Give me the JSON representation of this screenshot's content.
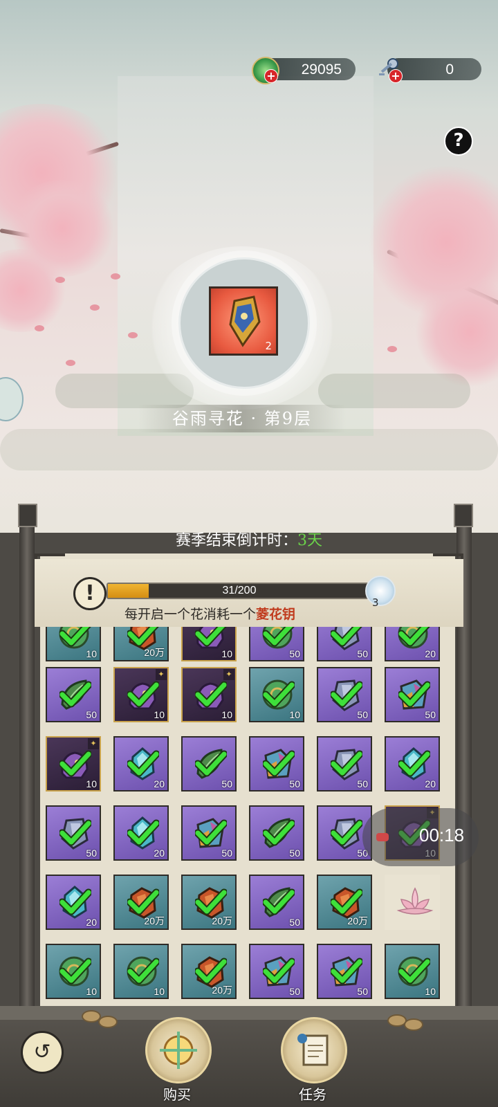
{
  "currency": {
    "jade": {
      "value": "29095",
      "icon": "jade-coin-icon"
    },
    "key": {
      "value": "0",
      "icon": "key-icon"
    }
  },
  "help": {
    "label": "?"
  },
  "reward": {
    "count": "2",
    "icon": "shield-charm-icon"
  },
  "stage_title": "谷雨寻花 · 第9层",
  "season": {
    "prefix": "赛季结束倒计时：",
    "days": "3天"
  },
  "progress": {
    "text": "31/200",
    "fraction": 0.155,
    "orb_count": "3"
  },
  "tip": {
    "prefix": "每开启一个花消耗一个",
    "key": "菱花钥"
  },
  "grid_rows": [
    [
      {
        "c": "blue",
        "g": "jade",
        "q": "10"
      },
      {
        "c": "blue",
        "g": "amber",
        "q": "20万"
      },
      {
        "c": "dark",
        "g": "beast",
        "q": "10"
      },
      {
        "c": "purple",
        "g": "jade",
        "q": "50"
      },
      {
        "c": "purple",
        "g": "crystal",
        "q": "50"
      },
      {
        "c": "purple",
        "g": "jade",
        "q": "20"
      }
    ],
    [
      {
        "c": "purple",
        "g": "leaf",
        "q": "50"
      },
      {
        "c": "dark",
        "g": "beast",
        "q": "10"
      },
      {
        "c": "dark",
        "g": "beast",
        "q": "10"
      },
      {
        "c": "blue",
        "g": "jade",
        "q": "10"
      },
      {
        "c": "purple",
        "g": "crystal",
        "q": "50"
      },
      {
        "c": "purple",
        "g": "rainbow",
        "q": "50"
      }
    ],
    [
      {
        "c": "dark",
        "g": "beast",
        "q": "10"
      },
      {
        "c": "purple",
        "g": "cyan",
        "q": "20"
      },
      {
        "c": "purple",
        "g": "leaf",
        "q": "50"
      },
      {
        "c": "purple",
        "g": "rainbow",
        "q": "50"
      },
      {
        "c": "purple",
        "g": "crystal",
        "q": "50"
      },
      {
        "c": "purple",
        "g": "cyan",
        "q": "20"
      }
    ],
    [
      {
        "c": "purple",
        "g": "crystal",
        "q": "50"
      },
      {
        "c": "purple",
        "g": "cyan",
        "q": "20"
      },
      {
        "c": "purple",
        "g": "rainbow",
        "q": "50"
      },
      {
        "c": "purple",
        "g": "leaf",
        "q": "50"
      },
      {
        "c": "purple",
        "g": "crystal",
        "q": "50"
      },
      {
        "c": "dark",
        "g": "beast",
        "q": "10"
      }
    ],
    [
      {
        "c": "purple",
        "g": "cyan",
        "q": "20"
      },
      {
        "c": "blue",
        "g": "amber",
        "q": "20万"
      },
      {
        "c": "blue",
        "g": "amber",
        "q": "20万"
      },
      {
        "c": "purple",
        "g": "leaf",
        "q": "50"
      },
      {
        "c": "blue",
        "g": "amber",
        "q": "20万"
      },
      {
        "c": "empty",
        "g": "lotus",
        "q": ""
      }
    ],
    [
      {
        "c": "blue",
        "g": "jade",
        "q": "10"
      },
      {
        "c": "blue",
        "g": "jade",
        "q": "10"
      },
      {
        "c": "blue",
        "g": "amber",
        "q": "20万"
      },
      {
        "c": "purple",
        "g": "rainbow",
        "q": "50"
      },
      {
        "c": "purple",
        "g": "rainbow",
        "q": "50"
      },
      {
        "c": "blue",
        "g": "jade",
        "q": "10"
      }
    ]
  ],
  "timer": "00:18",
  "nav": {
    "buy": "购买",
    "task": "任务"
  },
  "colors": {
    "accent_green": "#6bd34a",
    "key_red": "#c03a1d",
    "progress": "#f0b431"
  }
}
